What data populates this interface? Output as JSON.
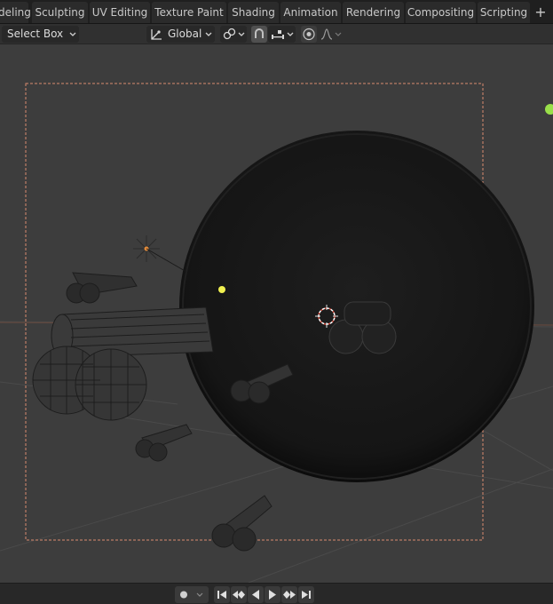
{
  "workspace_tabs": [
    {
      "label": "deling"
    },
    {
      "label": "Sculpting"
    },
    {
      "label": "UV Editing"
    },
    {
      "label": "Texture Paint"
    },
    {
      "label": "Shading"
    },
    {
      "label": "Animation"
    },
    {
      "label": "Rendering"
    },
    {
      "label": "Compositing"
    },
    {
      "label": "Scripting"
    }
  ],
  "add_workspace_label": "+",
  "header": {
    "select_mode": "Select Box",
    "transform_orientation": "Global",
    "icons": {
      "orientation": "transform-orientation-icon",
      "pivot": "pivot-point-icon",
      "snap": "snap-magnet-icon",
      "snap_target": "snap-increment-icon",
      "proportional": "proportional-editing-icon",
      "falloff": "falloff-curve-icon"
    }
  },
  "timeline": {
    "icons": [
      "record-icon",
      "jump-start-icon",
      "prev-keyframe-icon",
      "play-reverse-icon",
      "play-icon",
      "next-keyframe-icon",
      "jump-end-icon"
    ]
  },
  "colors": {
    "tabs_bg": "#1f1f1f",
    "tab_bg": "#2b2b2b",
    "header_bg": "#303030",
    "viewport_bg": "#3d3d3d",
    "camera_frame": "#e08a6a",
    "light_yellow": "#f0f050",
    "green_dot": "#9ae04a"
  }
}
